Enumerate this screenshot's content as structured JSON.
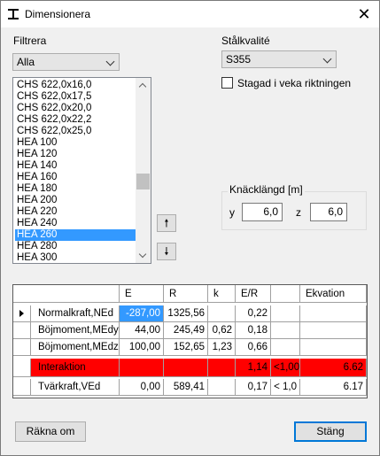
{
  "window": {
    "title": "Dimensionera",
    "close_symbol": "✕"
  },
  "filter": {
    "label": "Filtrera",
    "selected": "Alla"
  },
  "steel": {
    "label": "Stålkvalité",
    "selected": "S355",
    "braced_label": "Stagad i veka riktningen",
    "braced_checked": false
  },
  "profiles": {
    "items": [
      "CHS 622,0x16,0",
      "CHS 622,0x17,5",
      "CHS 622,0x20,0",
      "CHS 622,0x22,2",
      "CHS 622,0x25,0",
      "HEA 100",
      "HEA 120",
      "HEA 140",
      "HEA 160",
      "HEA 180",
      "HEA 200",
      "HEA 220",
      "HEA 240",
      "HEA 260",
      "HEA 280",
      "HEA 300"
    ],
    "selected_index": 13
  },
  "move_buttons": {
    "up": "🠕",
    "down": "🠗"
  },
  "buckling": {
    "title": "Knäcklängd [m]",
    "y_label": "y",
    "y_value": "6,0",
    "z_label": "z",
    "z_value": "6,0"
  },
  "table": {
    "headers": [
      "",
      "E",
      "R",
      "k",
      "E/R",
      "",
      "Ekvation"
    ],
    "rows": [
      {
        "label": "Normalkraft,NEd",
        "E": "-287,00",
        "R": "1325,56",
        "k": "",
        "ER": "0,22",
        "lim": "",
        "eq": "",
        "current": true,
        "highlight_E": true
      },
      {
        "label": "Böjmoment,MEdy",
        "E": "44,00",
        "R": "245,49",
        "k": "0,62",
        "ER": "0,18",
        "lim": "",
        "eq": ""
      },
      {
        "label": "Böjmoment,MEdz",
        "E": "100,00",
        "R": "152,65",
        "k": "1,23",
        "ER": "0,66",
        "lim": "",
        "eq": ""
      },
      {
        "label": "Interaktion",
        "E": "",
        "R": "",
        "k": "",
        "ER": "1,14",
        "lim": "<1,00",
        "eq": "6.62",
        "red": true
      },
      {
        "label": "Tvärkraft,VEd",
        "E": "0,00",
        "R": "589,41",
        "k": "",
        "ER": "0,17",
        "lim": "< 1,0",
        "eq": "6.17"
      }
    ]
  },
  "buttons": {
    "compute": "Räkna om",
    "close": "Stäng"
  },
  "colors": {
    "selection": "#3399ff",
    "fail": "#ff0000",
    "default_border": "#0078d7"
  }
}
